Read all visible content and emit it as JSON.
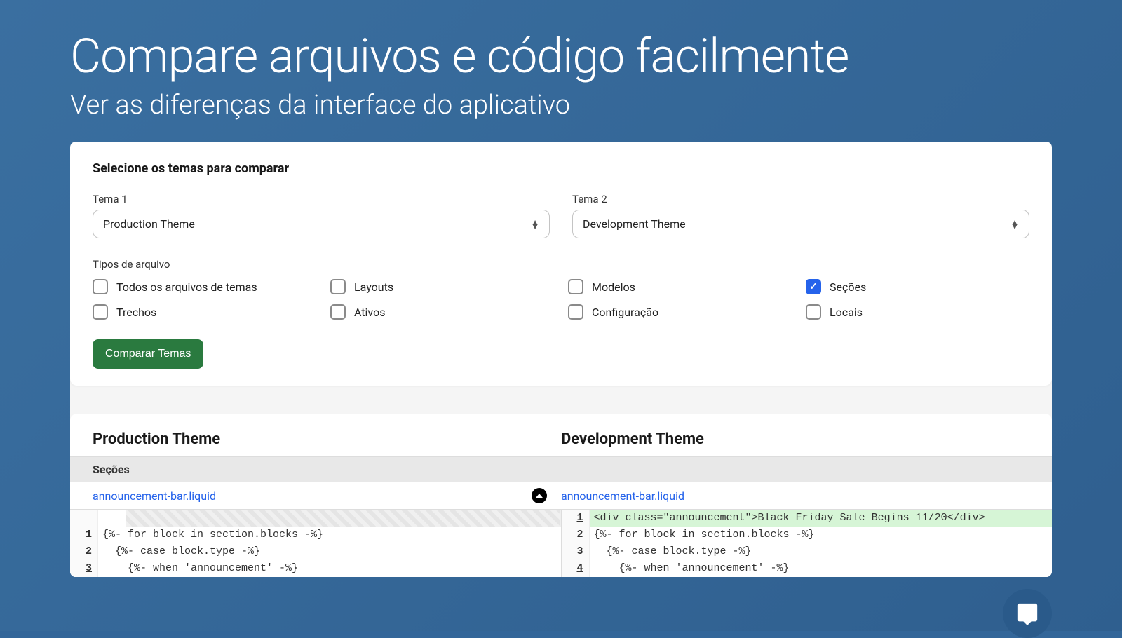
{
  "hero": {
    "title": "Compare arquivos e código facilmente",
    "subtitle": "Ver as diferenças da interface do aplicativo"
  },
  "form": {
    "title": "Selecione os temas para comparar",
    "theme1_label": "Tema 1",
    "theme1_value": "Production Theme",
    "theme2_label": "Tema 2",
    "theme2_value": "Development Theme",
    "filetypes_label": "Tipos de arquivo",
    "checkboxes": {
      "all": "Todos os arquivos de temas",
      "layouts": "Layouts",
      "templates": "Modelos",
      "sections": "Seções",
      "snippets": "Trechos",
      "assets": "Ativos",
      "config": "Configuração",
      "locales": "Locais"
    },
    "submit": "Comparar Temas"
  },
  "results": {
    "col1_title": "Production Theme",
    "col2_title": "Development Theme",
    "section_label": "Seções",
    "file_left": "announcement-bar.liquid",
    "file_right": "announcement-bar.liquid",
    "code_left": [
      {
        "num": "1",
        "text": "{%- for block in section.blocks -%}"
      },
      {
        "num": "2",
        "text": "  {%- case block.type -%}"
      },
      {
        "num": "3",
        "text": "    {%- when 'announcement' -%}"
      }
    ],
    "code_right": [
      {
        "num": "1",
        "text": "<div class=\"announcement\">Black Friday Sale Begins 11/20</div>",
        "added": true
      },
      {
        "num": "2",
        "text": "{%- for block in section.blocks -%}"
      },
      {
        "num": "3",
        "text": "  {%- case block.type -%}"
      },
      {
        "num": "4",
        "text": "    {%- when 'announcement' -%}"
      }
    ]
  },
  "colors": {
    "accent_blue": "#2563eb",
    "button_green": "#2a7a3f",
    "diff_added": "#d6f5d6"
  }
}
